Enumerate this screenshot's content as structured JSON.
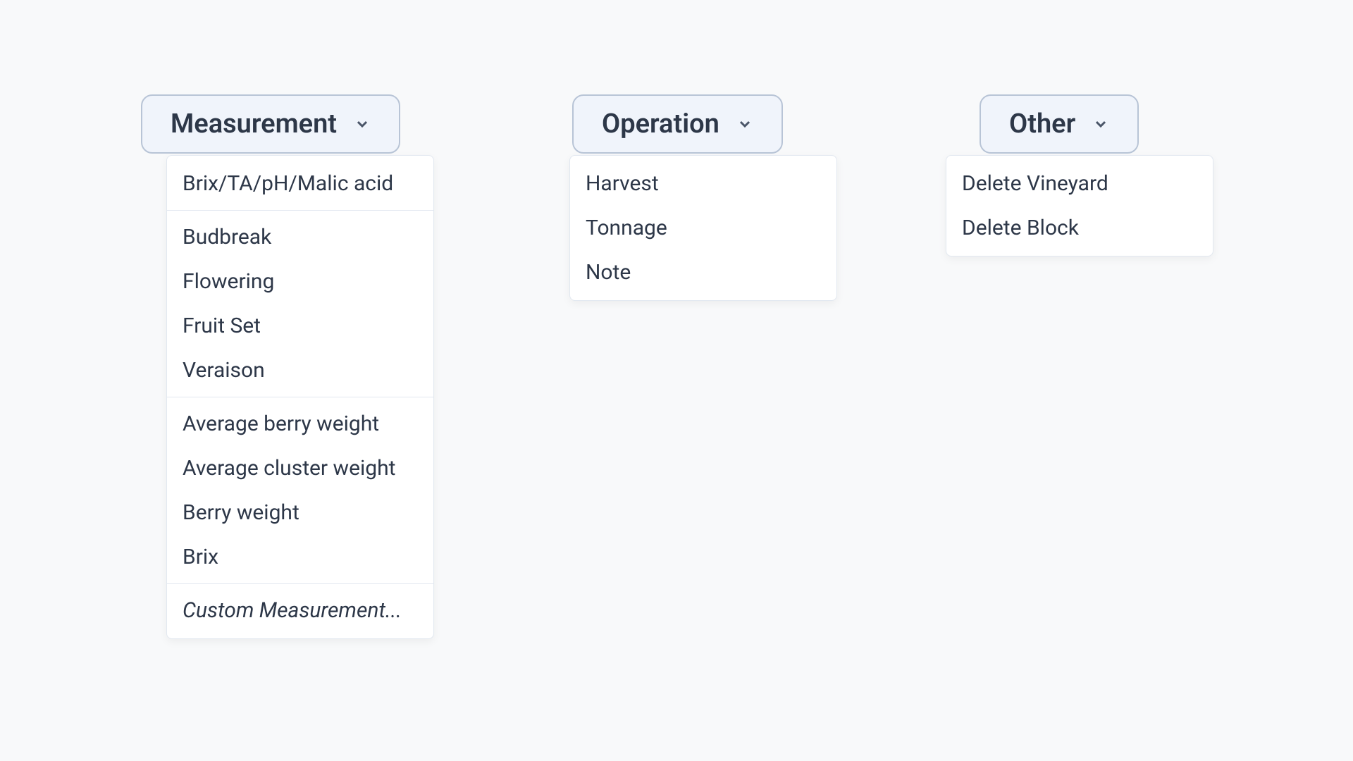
{
  "dropdowns": {
    "measurement": {
      "label": "Measurement",
      "groups": [
        [
          "Brix/TA/pH/Malic acid"
        ],
        [
          "Budbreak",
          "Flowering",
          "Fruit Set",
          "Veraison"
        ],
        [
          "Average berry weight",
          "Average cluster weight",
          "Berry weight",
          "Brix"
        ]
      ],
      "footer": "Custom Measurement..."
    },
    "operation": {
      "label": "Operation",
      "items": [
        "Harvest",
        "Tonnage",
        "Note"
      ]
    },
    "other": {
      "label": "Other",
      "items": [
        "Delete Vineyard",
        "Delete Block"
      ]
    }
  }
}
